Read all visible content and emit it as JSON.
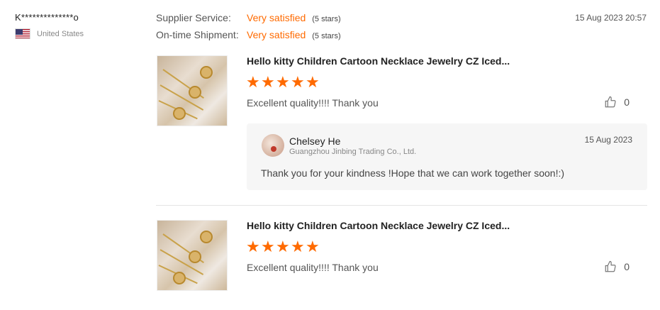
{
  "reviewer": {
    "name": "K**************o",
    "country": "United States",
    "flag_icon": "us-flag-icon"
  },
  "ratings": [
    {
      "label": "Supplier Service:",
      "value": "Very satisfied",
      "stars": "(5 stars)"
    },
    {
      "label": "On-time Shipment:",
      "value": "Very satisfied",
      "stars": "(5 stars)"
    }
  ],
  "timestamp": "15 Aug 2023 20:57",
  "reviews": [
    {
      "product_title": "Hello kitty Children Cartoon Necklace Jewelry CZ Iced...",
      "rating": 5,
      "comment": "Excellent quality!!!! Thank you",
      "likes": "0",
      "reply": {
        "name": "Chelsey He",
        "company": "Guangzhou Jinbing Trading Co., Ltd.",
        "date": "15 Aug 2023",
        "text": "Thank you for your kindness !Hope that we can work together soon!:)"
      }
    },
    {
      "product_title": "Hello kitty Children Cartoon Necklace Jewelry CZ Iced...",
      "rating": 5,
      "comment": "Excellent quality!!!! Thank you",
      "likes": "0"
    }
  ],
  "colors": {
    "accent": "#ff6a00",
    "reply_bg": "#f6f6f6",
    "divider": "#e5e5e5"
  }
}
